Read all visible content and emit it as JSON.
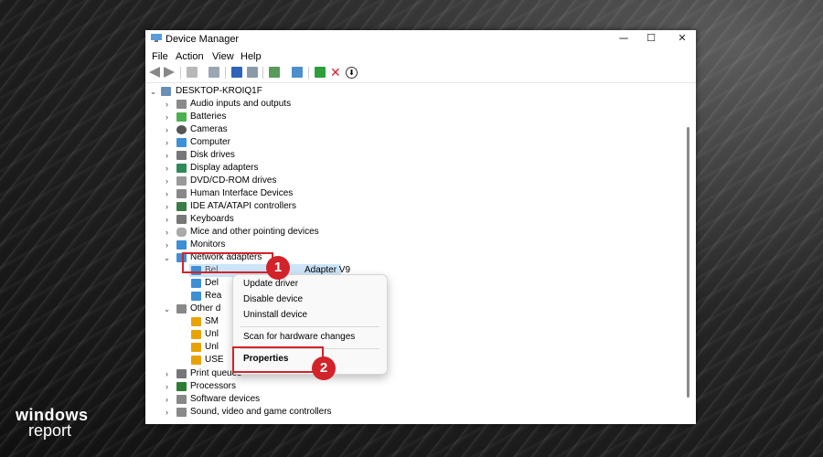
{
  "window": {
    "title": "Device Manager",
    "minimize": "─",
    "maximize": "☐",
    "close": "✕"
  },
  "menu": [
    "File",
    "Action",
    "View",
    "Help"
  ],
  "tree": {
    "root": "DESKTOP-KROIQ1F",
    "categories": [
      "Audio inputs and outputs",
      "Batteries",
      "Cameras",
      "Computer",
      "Disk drives",
      "Display adapters",
      "DVD/CD-ROM drives",
      "Human Interface Devices",
      "IDE ATA/ATAPI controllers",
      "Keyboards",
      "Mice and other pointing devices",
      "Monitors",
      "Network adapters"
    ],
    "network_children": [
      "Bel",
      "Del",
      "Rea"
    ],
    "network_child_tail": "Adapter V9",
    "other_devices": "Other d",
    "other_children": [
      "SM",
      "Unl",
      "Unl",
      "USE"
    ],
    "after": [
      "Print queues",
      "Processors",
      "Software devices",
      "Sound, video and game controllers"
    ]
  },
  "context_menu": {
    "update": "Update driver",
    "disable": "Disable device",
    "uninstall": "Uninstall device",
    "scan": "Scan for hardware changes",
    "properties": "Properties"
  },
  "badges": {
    "one": "1",
    "two": "2"
  },
  "logo": {
    "line1": "windows",
    "line2": "report"
  },
  "colors": {
    "highlight": "#d2232a",
    "warning": "#e8a300"
  }
}
